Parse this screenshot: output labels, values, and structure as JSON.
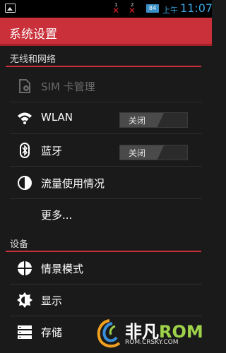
{
  "status_bar": {
    "sim1_label": "1",
    "sim2_label": "2",
    "battery": "84",
    "ampm": "上午",
    "time": "11:07",
    "time_color": "#3aa7e0",
    "no_signal_color": "#dd2222"
  },
  "action_bar": {
    "title": "系统设置",
    "color": "#c9303a"
  },
  "sections": [
    {
      "header": "无线和网络",
      "items": [
        {
          "label": "SIM 卡管理",
          "icon": "sim-card-icon",
          "enabled": false
        },
        {
          "label": "WLAN",
          "icon": "wifi-icon",
          "toggle": "关闭"
        },
        {
          "label": "蓝牙",
          "icon": "bluetooth-icon",
          "toggle": "关闭"
        },
        {
          "label": "流量使用情况",
          "icon": "data-usage-icon"
        },
        {
          "label": "更多...",
          "icon": ""
        }
      ]
    },
    {
      "header": "设备",
      "items": [
        {
          "label": "情景模式",
          "icon": "audio-profiles-icon"
        },
        {
          "label": "显示",
          "icon": "display-brightness-icon"
        },
        {
          "label": "存储",
          "icon": "storage-icon"
        }
      ]
    }
  ],
  "watermark": {
    "brand_cn": "非凡",
    "brand_rom": "ROM",
    "url": "ROM.CRSKY.COM"
  }
}
